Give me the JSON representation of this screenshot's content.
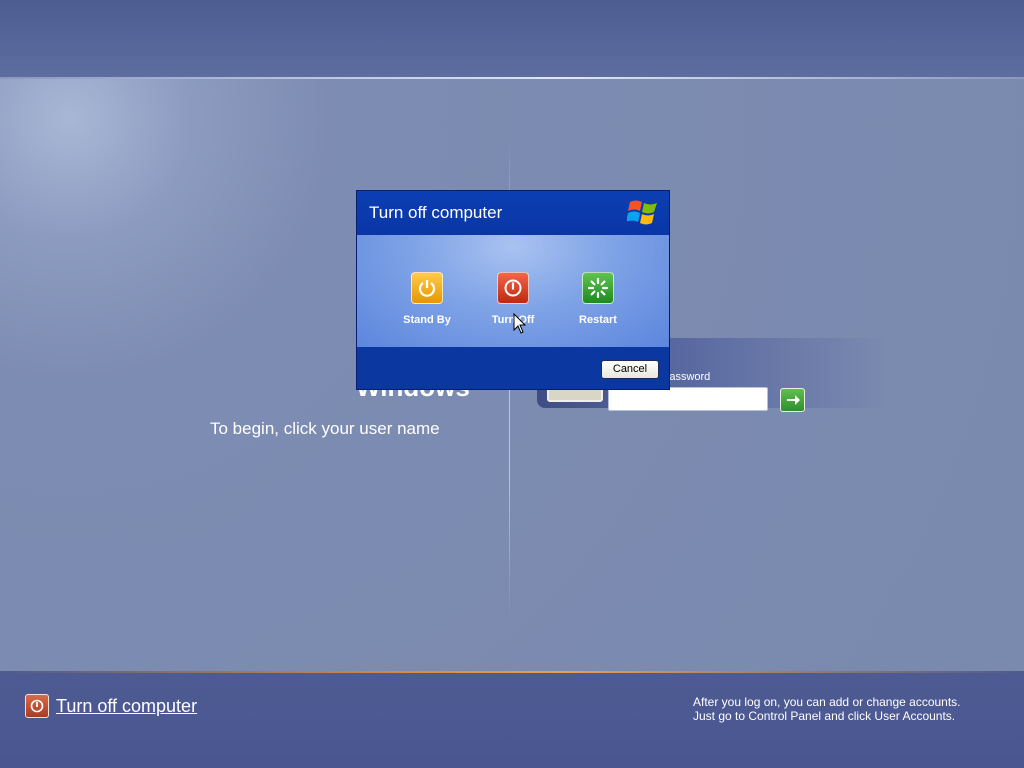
{
  "welcome": {
    "brand_text": "Windows",
    "begin_text": "To begin, click your user name",
    "password_label": "Password",
    "password_value": ""
  },
  "dialog": {
    "title": "Turn off computer",
    "options": [
      {
        "label": "Stand By",
        "icon": "standby-icon",
        "color": "#f0a81c"
      },
      {
        "label": "Turn Off",
        "icon": "power-icon",
        "color": "#d8401e"
      },
      {
        "label": "Restart",
        "icon": "restart-icon",
        "color": "#2f9b2a"
      }
    ],
    "cancel_label": "Cancel"
  },
  "bottom_bar": {
    "turn_off_label": "Turn off computer",
    "hint_line1": "After you log on, you can add or change accounts.",
    "hint_line2": "Just go to Control Panel and click User Accounts."
  },
  "colors": {
    "background": "#7d8cb2",
    "dialog_title_bar": "#0b3fb3",
    "dialog_body": "#7fa3e6"
  }
}
